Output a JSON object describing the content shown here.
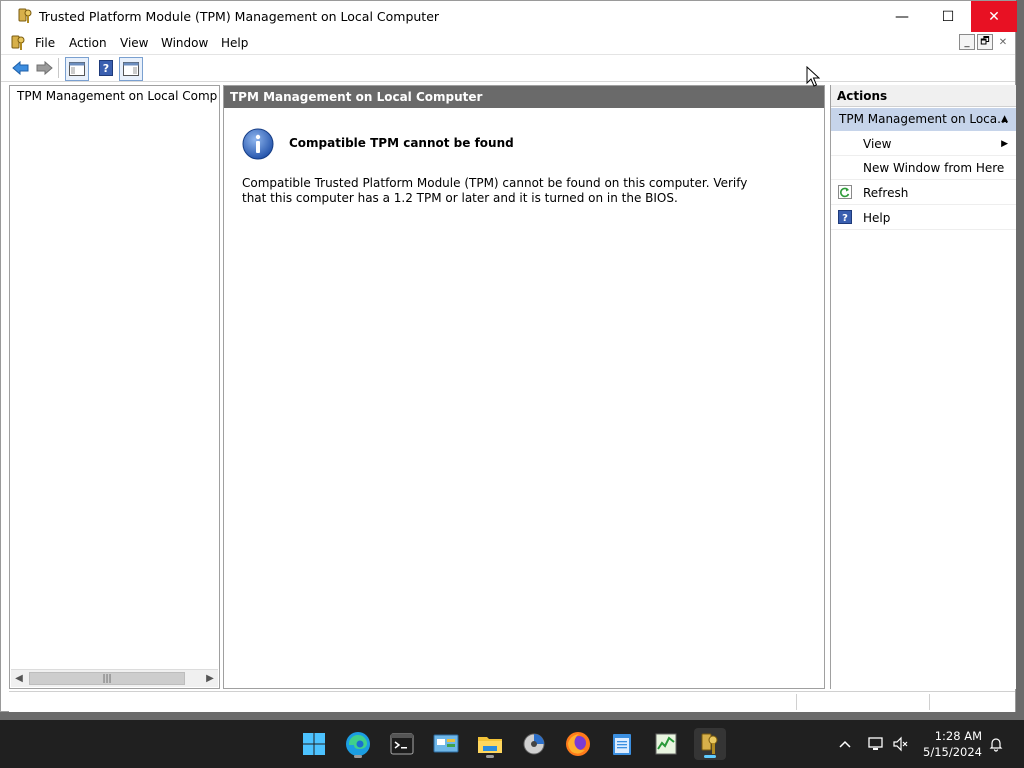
{
  "window": {
    "title": "Trusted Platform Module (TPM) Management on Local Computer",
    "controls": {
      "minimize": "—",
      "maximize": "☐",
      "close": "✕"
    }
  },
  "menubar": {
    "items": [
      "File",
      "Action",
      "View",
      "Window",
      "Help"
    ],
    "mdi": {
      "minimize": "_",
      "restore": "🗗",
      "close": "✕"
    }
  },
  "tree": {
    "items": [
      {
        "label": "TPM Management on Local Comp"
      }
    ]
  },
  "center": {
    "header": "TPM Management on Local Computer",
    "error_title": "Compatible TPM cannot be found",
    "error_description": "Compatible Trusted Platform Module (TPM) cannot be found on this computer. Verify that this computer has a 1.2 TPM or later and it is turned on in the BIOS."
  },
  "actions": {
    "header": "Actions",
    "section": "TPM Management on Loca...",
    "items": [
      {
        "label": "View",
        "has_submenu": true
      },
      {
        "label": "New Window from Here"
      },
      {
        "label": "Refresh",
        "icon": "refresh-icon"
      },
      {
        "label": "Help",
        "icon": "help-icon"
      }
    ]
  },
  "taskbar": {
    "apps": [
      "start",
      "edge",
      "terminal",
      "control-panel",
      "file-explorer",
      "disk-management",
      "firefox",
      "notepad",
      "task-manager",
      "tpm-management"
    ],
    "clock": {
      "time": "1:28 AM",
      "date": "5/15/2024"
    }
  },
  "colors": {
    "center_header_bg": "#6a6a6a",
    "actions_section_bg": "#c6d4ea",
    "close_button_bg": "#e81123",
    "taskbar_bg": "#202020",
    "accent": "#60cdff"
  }
}
